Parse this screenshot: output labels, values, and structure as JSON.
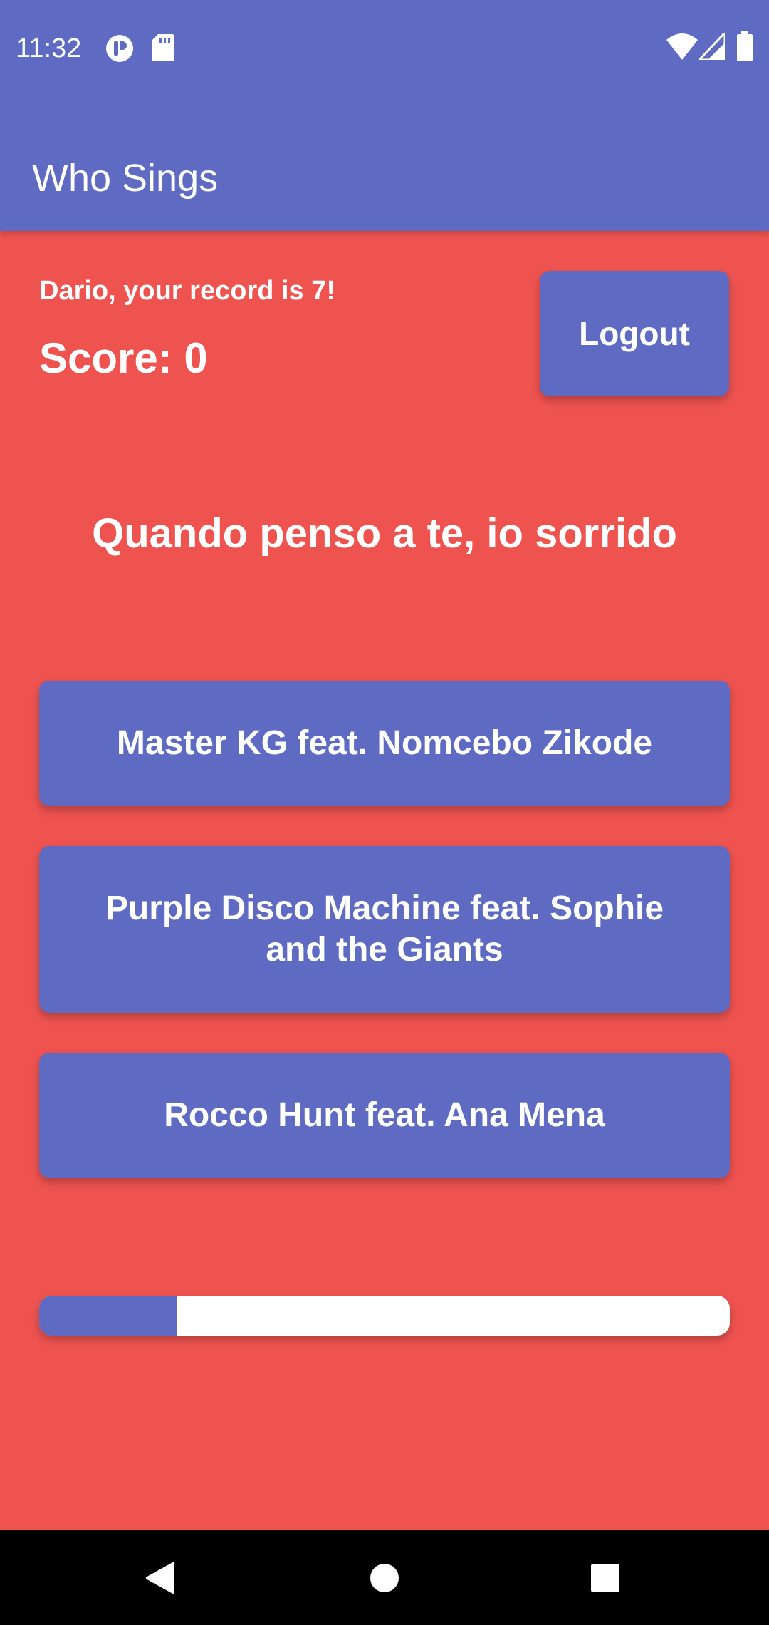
{
  "status_bar": {
    "time": "11:32",
    "icons": [
      "app-notification-icon",
      "sd-card-icon",
      "wifi-icon",
      "signal-icon",
      "battery-icon"
    ]
  },
  "app_bar": {
    "title": "Who Sings"
  },
  "player": {
    "record_text": "Dario, your record is 7!",
    "score_text": "Score: 0",
    "logout_label": "Logout"
  },
  "question": {
    "lyric": "Quando penso a te, io sorrido"
  },
  "answers": [
    {
      "label": "Master KG feat. Nomcebo Zikode"
    },
    {
      "label": "Purple Disco Machine feat. Sophie and the Giants"
    },
    {
      "label": "Rocco Hunt feat. Ana Mena"
    }
  ],
  "timer": {
    "progress_fraction": 0.2
  },
  "colors": {
    "primary": "#5F6BC2",
    "background": "#EF5350",
    "text": "#FFFFFF",
    "navbar": "#000000"
  },
  "nav_bar": {
    "icons": [
      "back-icon",
      "home-icon",
      "recents-icon"
    ]
  }
}
